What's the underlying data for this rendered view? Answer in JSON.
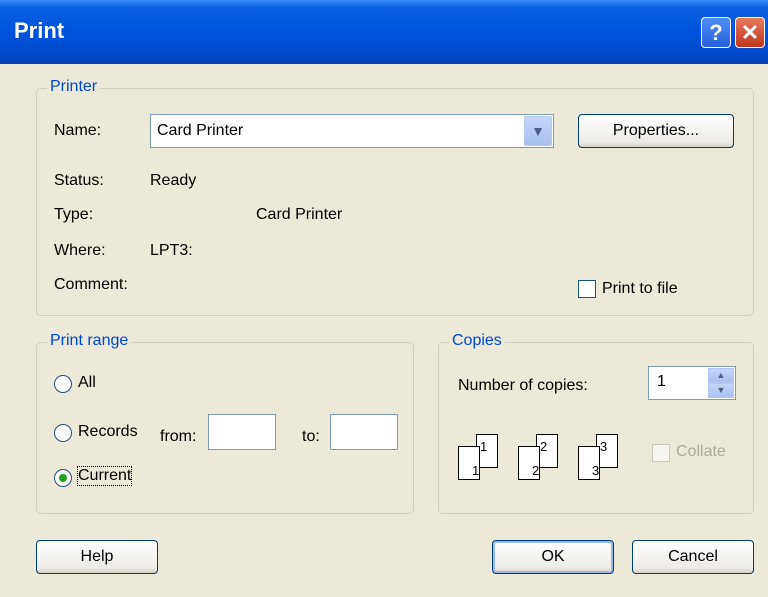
{
  "window": {
    "title": "Print"
  },
  "titlebar": {
    "help_glyph": "?",
    "close_glyph": "✕"
  },
  "printer": {
    "legend": "Printer",
    "name_label": "Name:",
    "name_value": "Card Printer",
    "properties_label": "Properties...",
    "status_label": "Status:",
    "status_value": "Ready",
    "type_label": "Type:",
    "type_value": "Card Printer",
    "where_label": "Where:",
    "where_value": "LPT3:",
    "comment_label": "Comment:",
    "comment_value": "",
    "print_to_file_label": "Print to file",
    "print_to_file_checked": false
  },
  "print_range": {
    "legend": "Print range",
    "all_label": "All",
    "records_label": "Records",
    "from_label": "from:",
    "from_value": "",
    "to_label": "to:",
    "to_value": "",
    "current_label": "Current",
    "selected": "Current"
  },
  "copies": {
    "legend": "Copies",
    "number_label": "Number of copies:",
    "number_value": "1",
    "collate_label": "Collate",
    "collate_checked": false,
    "collate_enabled": false,
    "pages": [
      "1",
      "1",
      "2",
      "2",
      "3",
      "3"
    ]
  },
  "buttons": {
    "help": "Help",
    "ok": "OK",
    "cancel": "Cancel"
  },
  "colors": {
    "titlebar": "#0053de",
    "group_legend": "#0046d5",
    "dialog_bg": "#ece9d8"
  }
}
